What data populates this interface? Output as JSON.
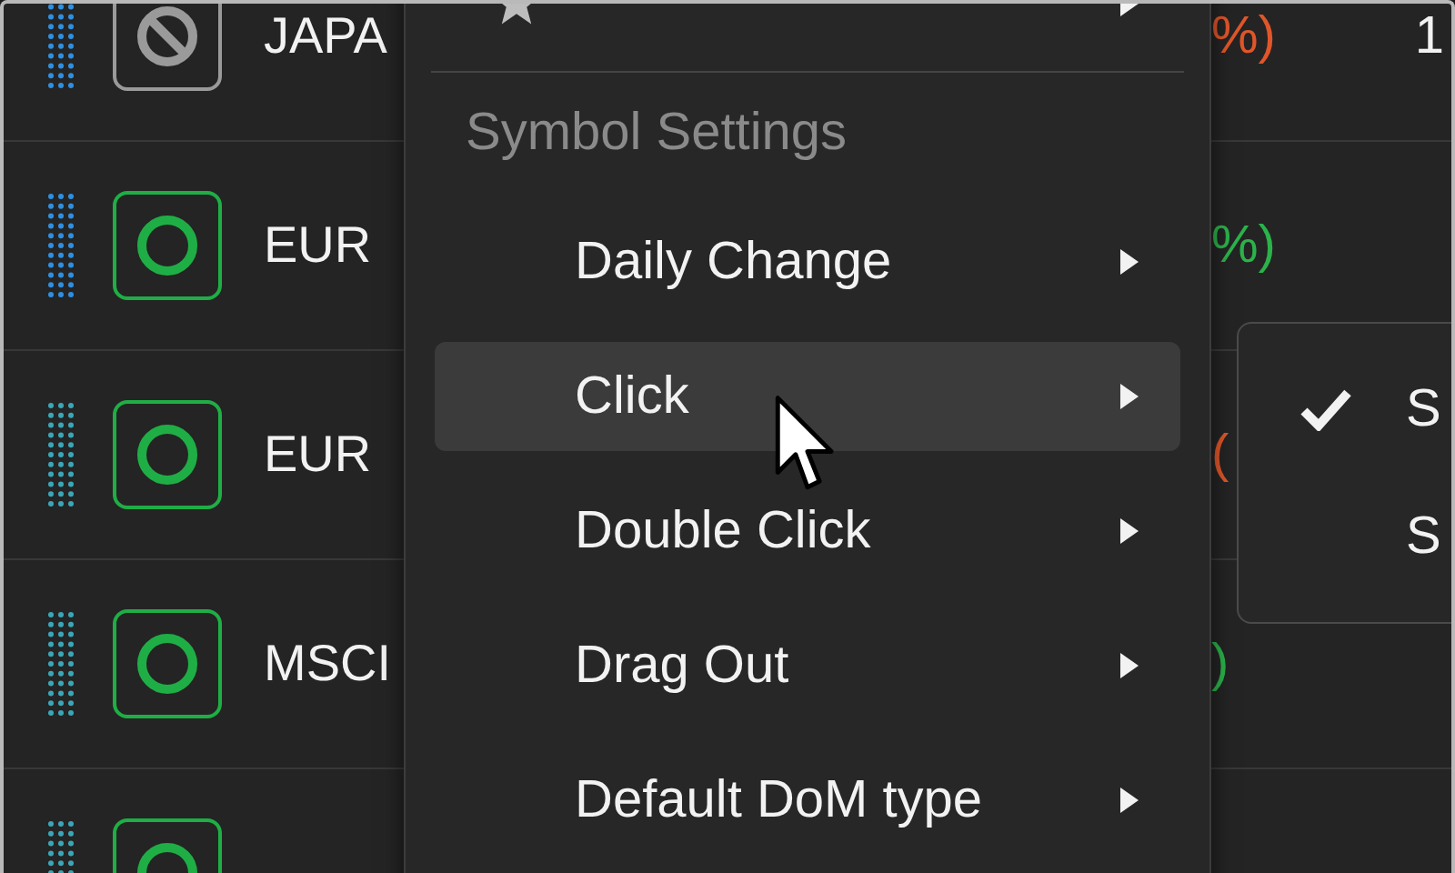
{
  "rows": [
    {
      "name": "JAPA",
      "kind": "blocked",
      "color": "#2f8fe0",
      "change": {
        "text": "%)",
        "color": "#e0562a"
      },
      "value": "1"
    },
    {
      "name": "EUR",
      "kind": "active",
      "color": "#2f8fe0",
      "change": {
        "text": "%)",
        "color": "#2bb34a"
      }
    },
    {
      "name": "EUR",
      "kind": "active",
      "color": "#3aa7b8",
      "change": {
        "text": "(",
        "color": "#e0562a"
      }
    },
    {
      "name": "MSCI",
      "kind": "active",
      "color": "#3aa7b8",
      "change": {
        "text": ")",
        "color": "#2bb34a"
      }
    },
    {
      "kind": "active",
      "color": "#3aa7b8"
    }
  ],
  "context_menu": {
    "section_header": "Symbol Settings",
    "items": [
      {
        "label": "Daily Change",
        "hovered": false
      },
      {
        "label": "Click",
        "hovered": true
      },
      {
        "label": "Double Click",
        "hovered": false
      },
      {
        "label": "Drag Out",
        "hovered": false
      },
      {
        "label": "Default DoM type",
        "hovered": false
      }
    ]
  },
  "submenu": {
    "items": [
      {
        "label": "S",
        "selected": true
      },
      {
        "label": "S",
        "selected": false
      }
    ]
  }
}
